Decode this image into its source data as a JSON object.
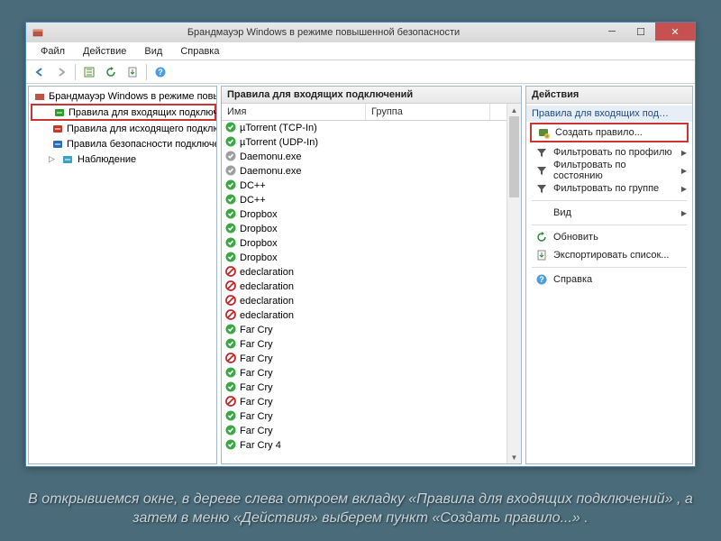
{
  "window": {
    "title": "Брандмауэр Windows в режиме повышенной безопасности"
  },
  "menubar": [
    "Файл",
    "Действие",
    "Вид",
    "Справка"
  ],
  "tree": {
    "root": "Брандмауэр Windows в режиме повышенной",
    "items": [
      {
        "label": "Правила для входящих подключений",
        "selected": true,
        "iconColor": "#2a9e2a"
      },
      {
        "label": "Правила для исходящего подключени",
        "selected": false,
        "iconColor": "#c43a2a"
      },
      {
        "label": "Правила безопасности подключения",
        "selected": false,
        "iconColor": "#2a6dbf"
      },
      {
        "label": "Наблюдение",
        "selected": false,
        "iconColor": "#3aa0c4",
        "expandable": true
      }
    ]
  },
  "list": {
    "title": "Правила для входящих подключений",
    "columns": {
      "name": "Имя",
      "group": "Группа"
    },
    "rows": [
      {
        "status": "allow",
        "name": "µTorrent (TCP-In)"
      },
      {
        "status": "allow",
        "name": "µTorrent (UDP-In)"
      },
      {
        "status": "disabled",
        "name": "Daemonu.exe"
      },
      {
        "status": "disabled",
        "name": "Daemonu.exe"
      },
      {
        "status": "allow",
        "name": "DC++"
      },
      {
        "status": "allow",
        "name": "DC++"
      },
      {
        "status": "allow",
        "name": "Dropbox"
      },
      {
        "status": "allow",
        "name": "Dropbox"
      },
      {
        "status": "allow",
        "name": "Dropbox"
      },
      {
        "status": "allow",
        "name": "Dropbox"
      },
      {
        "status": "block",
        "name": "edeclaration"
      },
      {
        "status": "block",
        "name": "edeclaration"
      },
      {
        "status": "block",
        "name": "edeclaration"
      },
      {
        "status": "block",
        "name": "edeclaration"
      },
      {
        "status": "allow",
        "name": "Far Cry"
      },
      {
        "status": "allow",
        "name": "Far Cry"
      },
      {
        "status": "block",
        "name": "Far Cry"
      },
      {
        "status": "allow",
        "name": "Far Cry"
      },
      {
        "status": "allow",
        "name": "Far Cry"
      },
      {
        "status": "block",
        "name": "Far Cry"
      },
      {
        "status": "allow",
        "name": "Far Cry"
      },
      {
        "status": "allow",
        "name": "Far Cry"
      },
      {
        "status": "allow",
        "name": "Far Cry 4"
      }
    ]
  },
  "actions": {
    "header": "Действия",
    "contextTitle": "Правила для входящих под…",
    "items": [
      {
        "label": "Создать правило...",
        "icon": "new-rule",
        "highlight": true
      },
      {
        "label": "Фильтровать по профилю",
        "icon": "filter",
        "submenu": true
      },
      {
        "label": "Фильтровать по состоянию",
        "icon": "filter",
        "submenu": true
      },
      {
        "label": "Фильтровать по группе",
        "icon": "filter",
        "submenu": true
      },
      {
        "sep": true
      },
      {
        "label": "Вид",
        "icon": "",
        "submenu": true
      },
      {
        "sep": true
      },
      {
        "label": "Обновить",
        "icon": "refresh"
      },
      {
        "label": "Экспортировать список...",
        "icon": "export"
      },
      {
        "sep": true
      },
      {
        "label": "Справка",
        "icon": "help"
      }
    ]
  },
  "caption_parts": {
    "p1": "В открывшемся окне, в дереве слева откроем вкладку «",
    "i1": "Правила для входящих подключений",
    "p2": "» , а затем в меню «",
    "i2": "Действия",
    "p3": "» выберем пункт «",
    "i3": "Создать правило...",
    "p4": "» ."
  }
}
